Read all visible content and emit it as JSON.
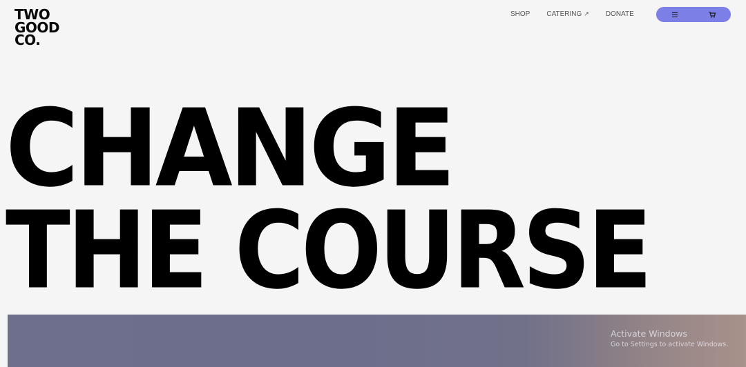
{
  "logo": {
    "line1": "TWO",
    "line2": "GOOD",
    "line3": "CO."
  },
  "nav": {
    "shop": "SHOP",
    "catering": "CATERING",
    "catering_arrow": "↗",
    "donate": "DONATE"
  },
  "pill": {
    "menu_icon": "menu-icon",
    "cart_icon": "cart-icon",
    "color": "#7b7fe6"
  },
  "hero": {
    "line1": "CHANGE",
    "line2": "THE COURSE"
  },
  "watermark": {
    "title": "Activate Windows",
    "subtitle": "Go to Settings to activate Windows."
  }
}
